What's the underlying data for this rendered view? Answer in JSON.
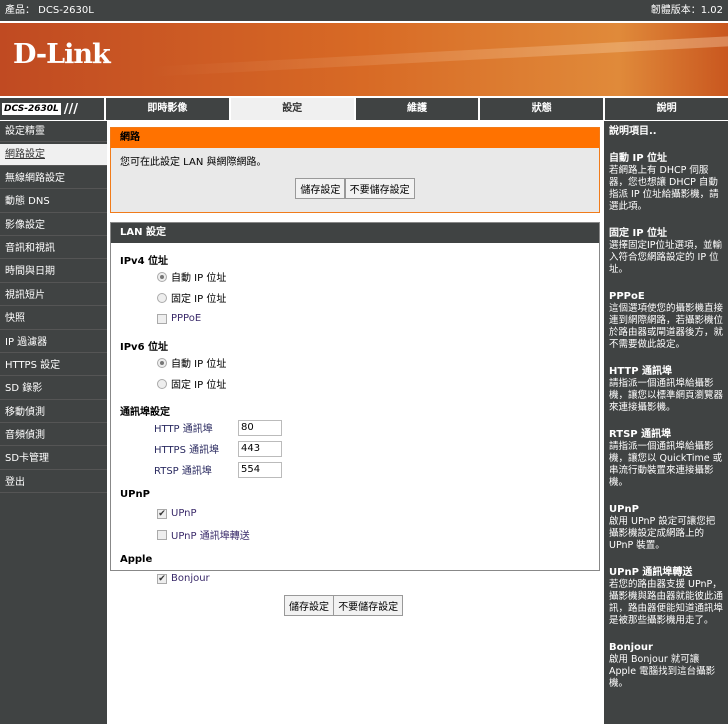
{
  "topbar": {
    "product": "產品： DCS-2630L",
    "firmware": "韌體版本：1.02"
  },
  "logo": "D-Link",
  "nav": {
    "model": "DCS-2630L",
    "tabs": [
      "即時影像",
      "設定",
      "維護",
      "狀態",
      "說明"
    ],
    "active": 1
  },
  "sidebar": {
    "items": [
      "設定精靈",
      "網路設定",
      "無線網路設定",
      "動態 DNS",
      "影像設定",
      "音訊和視訊",
      "時間與日期",
      "視訊短片",
      "快照",
      "IP 過濾器",
      "HTTPS 設定",
      "SD 錄影",
      "移動偵測",
      "音頻偵測",
      "SD卡管理",
      "登出"
    ],
    "active": 1
  },
  "network": {
    "title": "網路",
    "description": "您可在此設定 LAN 與網際網路。",
    "save": "儲存設定",
    "dont_save": "不要儲存設定"
  },
  "lan": {
    "title": "LAN 設定",
    "ipv4": {
      "label": "IPv4 位址",
      "auto": "自動 IP 位址",
      "static": "固定 IP 位址",
      "pppoe": "PPPoE"
    },
    "ipv6": {
      "label": "IPv6 位址",
      "auto": "自動 IP 位址",
      "static": "固定 IP 位址"
    },
    "ports": {
      "label": "通訊埠設定",
      "http_label": "HTTP 通訊埠",
      "http": "80",
      "https_label": "HTTPS 通訊埠",
      "https": "443",
      "rtsp_label": "RTSP 通訊埠",
      "rtsp": "554"
    },
    "upnp": {
      "label": "UPnP",
      "upnp": "UPnP",
      "forward": "UPnP 通訊埠轉送"
    },
    "apple": {
      "label": "Apple",
      "bonjour": "Bonjour"
    }
  },
  "bottom": {
    "save": "儲存設定",
    "dont_save": "不要儲存設定"
  },
  "help": {
    "title": "說明項目..",
    "items": [
      {
        "h": "自動 IP 位址",
        "t": "若網路上有 DHCP 伺服器，您也想讓 DHCP 自動指派 IP 位址給攝影機，請選此項。"
      },
      {
        "h": "固定 IP 位址",
        "t": "選擇固定IP位址選項，並輸入符合您網路設定的 IP 位址。"
      },
      {
        "h": "PPPoE",
        "t": "這個選項使您的攝影機直接連到網際網路，若攝影機位於路由器或閘道器後方，就不需要做此設定。"
      },
      {
        "h": "HTTP 通訊埠",
        "t": "請指派一個通訊埠給攝影機，讓您以標準網頁瀏覽器來連接攝影機。"
      },
      {
        "h": "RTSP 通訊埠",
        "t": "請指派一個通訊埠給攝影機，讓您以 QuickTime 或串流行動裝置來連接攝影機。"
      },
      {
        "h": "UPnP",
        "t": "啟用 UPnP 設定可讓您把攝影機設定成網路上的 UPnP 裝置。"
      },
      {
        "h": "UPnP 通訊埠轉送",
        "t": "若您的路由器支援 UPnP，攝影機與路由器就能彼此通訊，路由器便能知道通訊埠是被那些攝影機用走了。"
      },
      {
        "h": "Bonjour",
        "t": "啟用 Bonjour 就可讓 Apple 電腦找到這台攝影機。"
      }
    ]
  }
}
